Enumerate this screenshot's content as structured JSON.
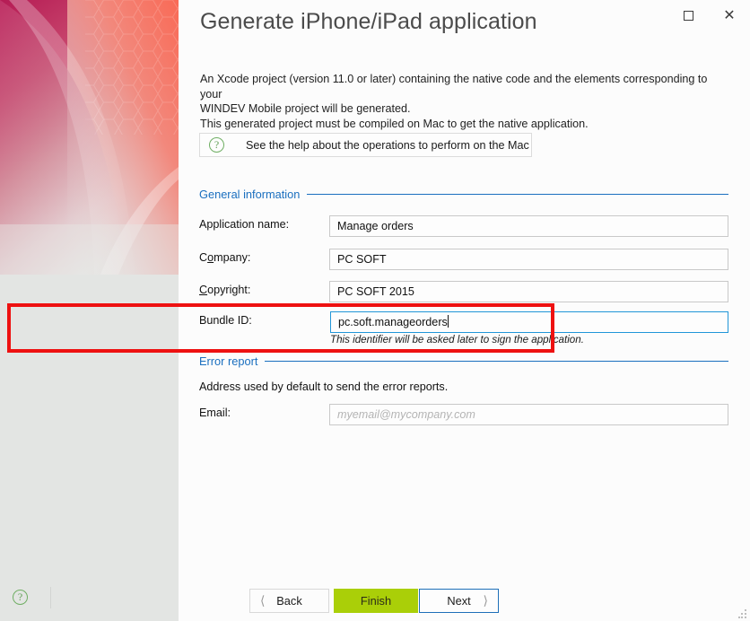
{
  "window": {
    "title": "Generate iPhone/iPad application",
    "maximize_icon": "maximize-icon",
    "close_icon": "close-icon"
  },
  "description": {
    "line1": "An Xcode project (version 11.0 or later) containing the native code and the elements corresponding to your",
    "line2": "WINDEV Mobile project will be generated.",
    "line3": "This generated project must be compiled on Mac to get the native application."
  },
  "help_button": {
    "label": "See the help about the operations to perform on the Mac",
    "icon": "question-circle-icon"
  },
  "sections": {
    "general": {
      "title": "General information"
    },
    "error": {
      "title": "Error report",
      "description": "Address used by default to send the error reports."
    }
  },
  "fields": {
    "app_name": {
      "label": "Application name:",
      "value": "Manage orders"
    },
    "company": {
      "label_pre": "C",
      "label_accel": "o",
      "label_post": "mpany:",
      "value": "PC SOFT"
    },
    "copyright": {
      "label_accel": "C",
      "label_post": "opyright:",
      "value": "PC SOFT 2015"
    },
    "bundle_id": {
      "label": "Bundle ID:",
      "value": "pc.soft.manageorders",
      "hint": "This identifier will be asked later to sign the application."
    },
    "email": {
      "label": "Email:",
      "value": "",
      "placeholder": "myemail@mycompany.com"
    }
  },
  "footer": {
    "back_label": "Back",
    "back_icon": "chevron-left-icon",
    "finish_label": "Finish",
    "next_label": "Next",
    "next_icon": "chevron-right-icon",
    "help_icon": "question-circle-icon"
  },
  "colors": {
    "accent_blue": "#1a6fbf",
    "finish_green": "#aacf08",
    "focus_blue": "#2196d8",
    "highlight_red": "#ee1111",
    "sidebar_gray": "#e3e5e3"
  }
}
